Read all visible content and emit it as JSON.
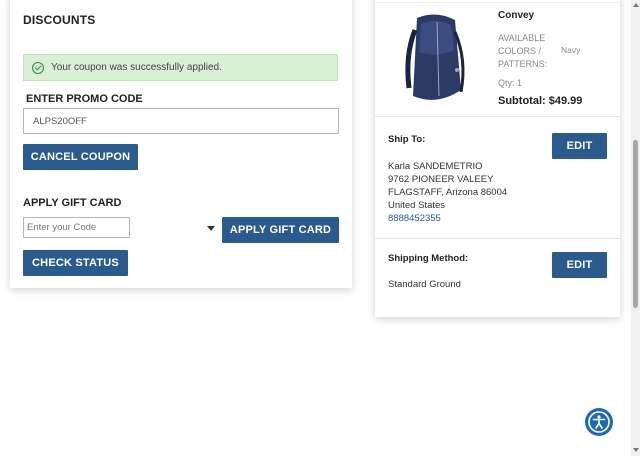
{
  "discounts": {
    "title": "DISCOUNTS",
    "success_message": "Your coupon was successfully applied.",
    "promo_label": "ENTER PROMO CODE",
    "promo_value": "ALPS20OFF",
    "cancel_coupon": "CANCEL COUPON",
    "gift_label": "APPLY GIFT CARD",
    "gift_placeholder": "Enter your Code",
    "apply_gift": "APPLY GIFT CARD",
    "check_status": "CHECK STATUS"
  },
  "summary": {
    "product_name": "Convey",
    "colors_label": "AVAILABLE COLORS / PATTERNS:",
    "colors_value": "Navy",
    "qty_label": "Qty:",
    "qty_value": "1",
    "subtotal_label": "Subtotal:",
    "subtotal_value": "$49.99",
    "ship_to_label": "Ship To:",
    "edit": "EDIT",
    "address": {
      "name": "Karla SANDEMETRIO",
      "line1": "9762 PIONEER VALEEY",
      "line2": "FLAGSTAFF, Arizona 86004",
      "country": "United States",
      "phone": "8888452355"
    },
    "shipping_method_label": "Shipping Method:",
    "shipping_method_value": "Standard Ground"
  },
  "colors": {
    "button": "#2b5a8c",
    "success_bg": "#d9f0d7",
    "link": "#2b5a8c",
    "accessibility": "#1e6ab2"
  },
  "icons": {
    "success": "check-circle-icon",
    "accessibility": "accessibility-icon",
    "dropdown": "caret-down-icon"
  }
}
